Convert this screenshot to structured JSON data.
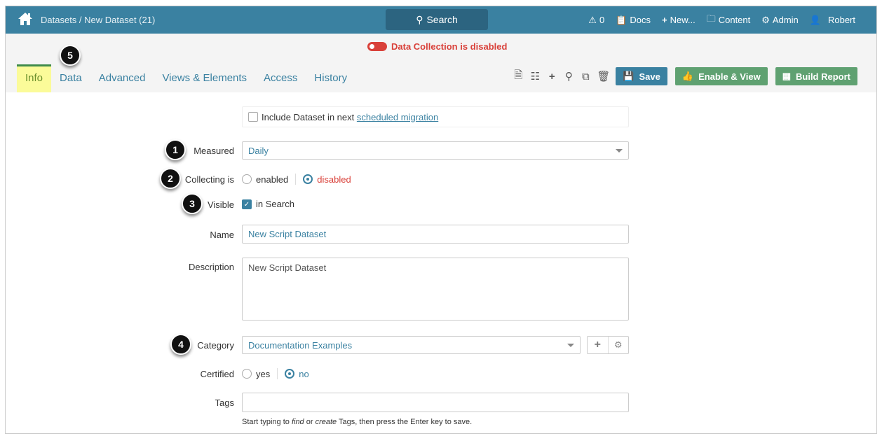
{
  "header": {
    "breadcrumb": "Datasets / New Dataset (21)",
    "search_label": "Search",
    "alerts_count": "0",
    "docs": "Docs",
    "new": "New...",
    "content": "Content",
    "admin": "Admin",
    "user": "Robert"
  },
  "status": {
    "text": "Data Collection is disabled",
    "color": "#d9413a"
  },
  "tabs": [
    {
      "label": "Info"
    },
    {
      "label": "Data"
    },
    {
      "label": "Advanced"
    },
    {
      "label": "Views & Elements"
    },
    {
      "label": "Access"
    },
    {
      "label": "History"
    }
  ],
  "toolbar": {
    "save": "Save",
    "enable_view": "Enable & View",
    "build_report": "Build Report"
  },
  "badges": [
    "1",
    "2",
    "3",
    "4",
    "5"
  ],
  "form": {
    "migration_prefix": "Include Dataset in next",
    "migration_link": "scheduled migration",
    "measured_label": "Measured",
    "measured_value": "Daily",
    "collecting_label": "Collecting is",
    "collecting_enabled": "enabled",
    "collecting_disabled": "disabled",
    "visible_label": "Visible",
    "visible_option": "in Search",
    "name_label": "Name",
    "name_value": "New Script Dataset",
    "description_label": "Description",
    "description_value": "New Script Dataset",
    "category_label": "Category",
    "category_value": "Documentation Examples",
    "certified_label": "Certified",
    "certified_yes": "yes",
    "certified_no": "no",
    "tags_label": "Tags",
    "tags_value": "",
    "tags_help_1": "Start typing to ",
    "tags_help_find": "find",
    "tags_help_2": " or ",
    "tags_help_create": "create",
    "tags_help_3": " Tags, then press the Enter key to save."
  }
}
